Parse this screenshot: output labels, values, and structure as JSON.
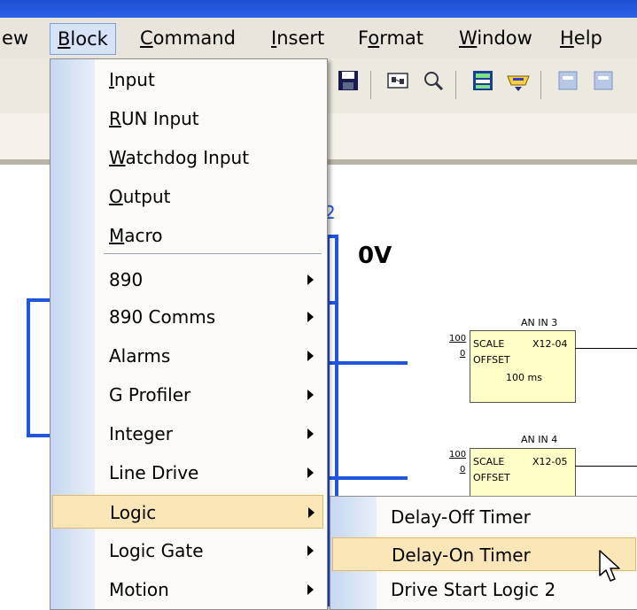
{
  "menubar": {
    "items": [
      {
        "label": "ew",
        "underline": ""
      },
      {
        "label": "Block",
        "underline": "B"
      },
      {
        "label": "Command",
        "underline": "C"
      },
      {
        "label": "Insert",
        "underline": "I"
      },
      {
        "label": "Format",
        "underline": "o"
      },
      {
        "label": "Window",
        "underline": "W"
      },
      {
        "label": "Help",
        "underline": "H"
      }
    ]
  },
  "toolbar": {
    "icons": [
      "save-icon",
      "connect-icon",
      "zoom-icon",
      "block-icon",
      "port-icon",
      "tile-icon",
      "tile2-icon"
    ]
  },
  "diagram": {
    "partial_label": "2",
    "supply_label": "0V",
    "blocks": [
      {
        "title": "AN IN 3",
        "in_top": "100",
        "in_bot": "0",
        "row1": "SCALE",
        "out": "X12-04",
        "row2": "OFFSET",
        "row3": "100 ms"
      },
      {
        "title": "AN IN 4",
        "in_top": "100",
        "in_bot": "0",
        "row1": "SCALE",
        "out": "X12-05",
        "row2": "OFFSET",
        "row3": ""
      }
    ]
  },
  "block_menu": {
    "items": [
      {
        "pre": "",
        "u": "I",
        "post": "nput",
        "submenu": false
      },
      {
        "pre": "",
        "u": "R",
        "post": "UN Input",
        "submenu": false
      },
      {
        "pre": "",
        "u": "W",
        "post": "atchdog Input",
        "submenu": false
      },
      {
        "pre": "",
        "u": "O",
        "post": "utput",
        "submenu": false
      },
      {
        "pre": "",
        "u": "M",
        "post": "acro",
        "submenu": false
      },
      {
        "pre": "890",
        "u": "",
        "post": "",
        "submenu": true
      },
      {
        "pre": "890 Comms",
        "u": "",
        "post": "",
        "submenu": true
      },
      {
        "pre": "Alarms",
        "u": "",
        "post": "",
        "submenu": true
      },
      {
        "pre": "G Profiler",
        "u": "",
        "post": "",
        "submenu": true
      },
      {
        "pre": "Integer",
        "u": "",
        "post": "",
        "submenu": true
      },
      {
        "pre": "Line Drive",
        "u": "",
        "post": "",
        "submenu": true
      },
      {
        "pre": "Logic",
        "u": "",
        "post": "",
        "submenu": true
      },
      {
        "pre": "Logic Gate",
        "u": "",
        "post": "",
        "submenu": true
      },
      {
        "pre": "Motion",
        "u": "",
        "post": "",
        "submenu": true
      }
    ],
    "highlighted": "Logic"
  },
  "logic_submenu": {
    "items": [
      "Delay-Off Timer",
      "Delay-On Timer",
      "Drive Start Logic 2"
    ],
    "highlighted": "Delay-On Timer"
  },
  "colors": {
    "menu_highlight": "#fbe6b8",
    "wire": "#2255dd",
    "block_fill": "#fffec6"
  }
}
